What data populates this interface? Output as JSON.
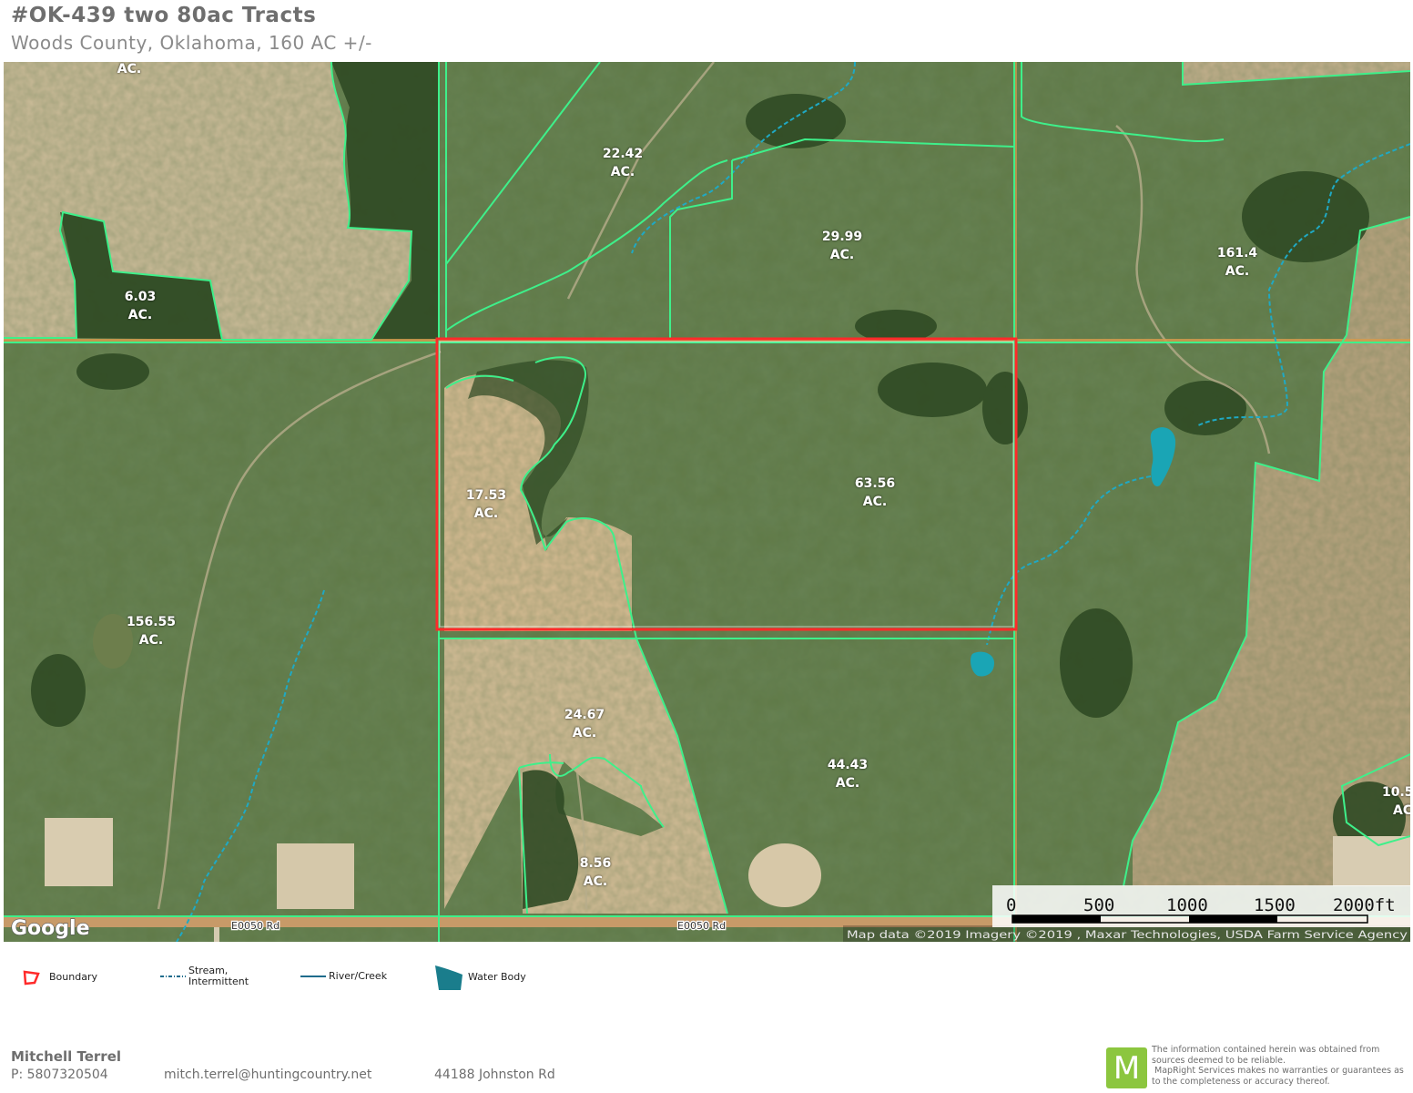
{
  "header": {
    "title": "#OK-439 two 80ac Tracts",
    "subtitle": "Woods County, Oklahoma, 160 AC +/-"
  },
  "map": {
    "parcel_labels": [
      {
        "id": "top-left",
        "value": "AC."
      },
      {
        "id": "22-42",
        "value": "22.42",
        "unit": "AC."
      },
      {
        "id": "29-99",
        "value": "29.99",
        "unit": "AC."
      },
      {
        "id": "161-4",
        "value": "161.4",
        "unit": "AC."
      },
      {
        "id": "6-03",
        "value": "6.03",
        "unit": "AC."
      },
      {
        "id": "17-53",
        "value": "17.53",
        "unit": "AC."
      },
      {
        "id": "63-56",
        "value": "63.56",
        "unit": "AC."
      },
      {
        "id": "156-55",
        "value": "156.55",
        "unit": "AC."
      },
      {
        "id": "24-67",
        "value": "24.67",
        "unit": "AC."
      },
      {
        "id": "44-43",
        "value": "44.43",
        "unit": "AC."
      },
      {
        "id": "8-56",
        "value": "8.56",
        "unit": "AC."
      },
      {
        "id": "10-5",
        "value": "10.5",
        "unit": "AC"
      }
    ],
    "road_labels": [
      "E0050 Rd",
      "E0050 Rd"
    ],
    "watermark": "Google",
    "attribution": "Map data ©2019  Imagery ©2019 , Maxar Technologies, USDA Farm Service Agency",
    "scale_bar": {
      "ticks": [
        "0",
        "500",
        "1000",
        "1500",
        "2000ft"
      ]
    },
    "colors": {
      "boundary": "#ff2a2a",
      "parcel_line": "#3ef08a",
      "stream": "#1fa9c4",
      "water_body": "#1aa5b5",
      "road": "#e3a35a"
    }
  },
  "legend": {
    "boundary": "Boundary",
    "stream": [
      "Stream,",
      "Intermittent"
    ],
    "river": "River/Creek",
    "water_body": "Water Body"
  },
  "footer": {
    "name": "Mitchell Terrel",
    "phone": "P: 5807320504",
    "email": "mitch.terrel@huntingcountry.net",
    "address": "44188 Johnston Rd",
    "logo_letter": "M",
    "disclaimer": [
      "The information contained herein was obtained from",
      "sources deemed to be reliable.",
      " MapRight Services makes no warranties or guarantees as",
      "to the completeness or accuracy thereof."
    ]
  }
}
